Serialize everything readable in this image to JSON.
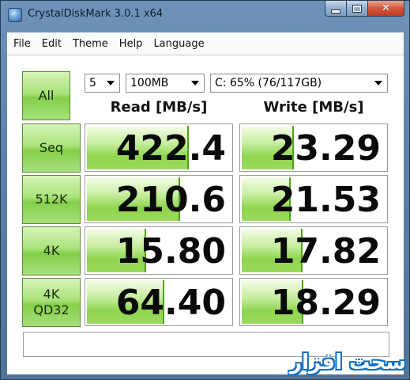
{
  "window": {
    "title": "CrystalDiskMark 3.0.1 x64"
  },
  "menu": [
    "File",
    "Edit",
    "Theme",
    "Help",
    "Language"
  ],
  "controls": {
    "all_label": "All",
    "runs": "5",
    "size": "100MB",
    "drive": "C: 65% (76/117GB)"
  },
  "headers": {
    "read": "Read [MB/s]",
    "write": "Write [MB/s]"
  },
  "rows": [
    {
      "label": "Seq",
      "read": "422.4",
      "write": "23.29",
      "read_fill": 0.7,
      "write_fill": 0.35
    },
    {
      "label": "512K",
      "read": "210.6",
      "write": "21.53",
      "read_fill": 0.64,
      "write_fill": 0.33
    },
    {
      "label": "4K",
      "read": "15.80",
      "write": "17.82",
      "read_fill": 0.4,
      "write_fill": 0.41
    },
    {
      "label": "4K\nQD32",
      "read": "64.40",
      "write": "18.29",
      "read_fill": 0.53,
      "write_fill": 0.42
    }
  ],
  "comment": "",
  "watermark": "سحت افزار",
  "colors": {
    "accent_green": "#84cf4a",
    "bar_edge": "#4ea21a",
    "close_red": "#c23b1f"
  }
}
